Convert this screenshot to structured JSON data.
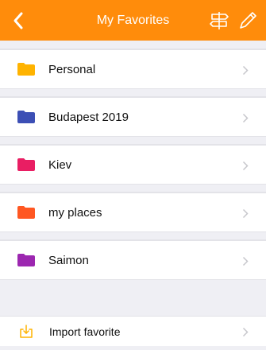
{
  "header": {
    "title": "My Favorites",
    "color": "#ff8c0b"
  },
  "favorites": [
    {
      "label": "Personal",
      "color": "#ffb300"
    },
    {
      "label": "Budapest 2019",
      "color": "#3c4fb5"
    },
    {
      "label": "Kiev",
      "color": "#e91e63"
    },
    {
      "label": "my places",
      "color": "#ff5722"
    },
    {
      "label": "Saimon",
      "color": "#9c27b0"
    }
  ],
  "import": {
    "label": "Import favorite",
    "icon": "import-icon",
    "color": "#ffb300"
  }
}
